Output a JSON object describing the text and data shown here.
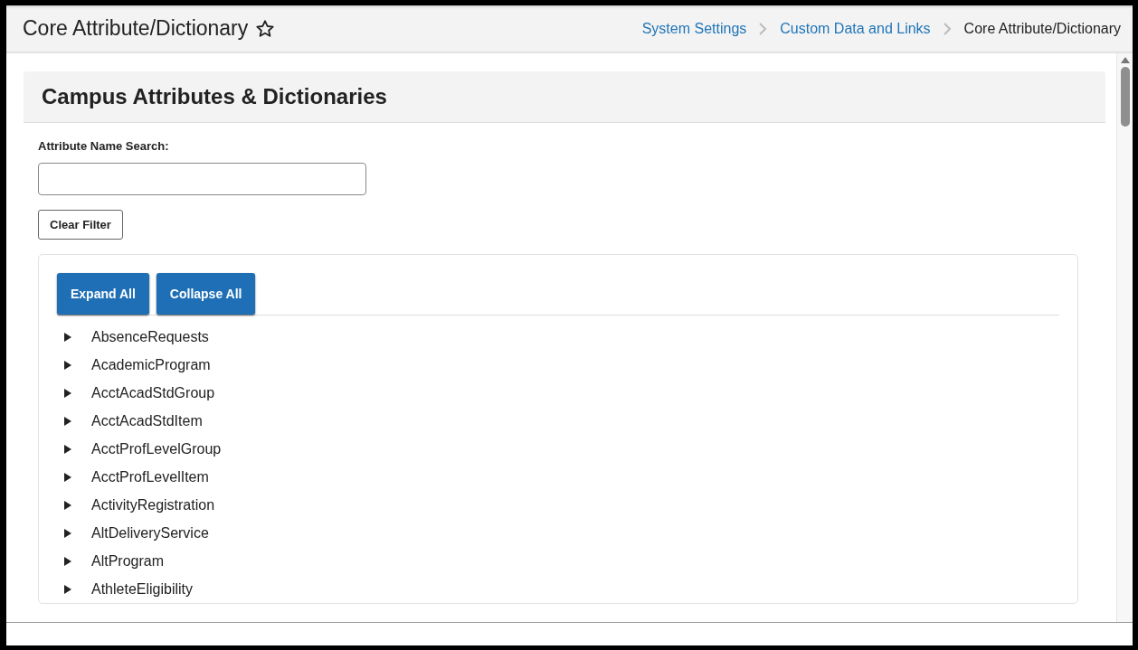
{
  "header": {
    "title": "Core Attribute/Dictionary",
    "favorite": false,
    "breadcrumbs": [
      {
        "label": "System Settings",
        "kind": "link"
      },
      {
        "label": "Custom Data and Links",
        "kind": "link"
      },
      {
        "label": "Core Attribute/Dictionary",
        "kind": "current"
      }
    ]
  },
  "panel": {
    "title": "Campus Attributes & Dictionaries"
  },
  "search": {
    "label": "Attribute Name Search:"
  },
  "clear_button": "Clear Filter",
  "tree_buttons": [
    "Expand All",
    "Collapse All"
  ],
  "tree": [
    {
      "label": "AbsenceRequests",
      "expanded": false
    },
    {
      "label": "AcademicProgram",
      "expanded": false
    },
    {
      "label": "AcctAcadStdGroup",
      "expanded": false
    },
    {
      "label": "AcctAcadStdItem",
      "expanded": false
    },
    {
      "label": "AcctProfLevelGroup",
      "expanded": false
    },
    {
      "label": "AcctProfLevelItem",
      "expanded": false
    },
    {
      "label": "ActivityRegistration",
      "expanded": false
    },
    {
      "label": "AltDeliveryService",
      "expanded": false
    },
    {
      "label": "AltProgram",
      "expanded": false
    },
    {
      "label": "AthleteEligibility",
      "expanded": false
    }
  ]
}
